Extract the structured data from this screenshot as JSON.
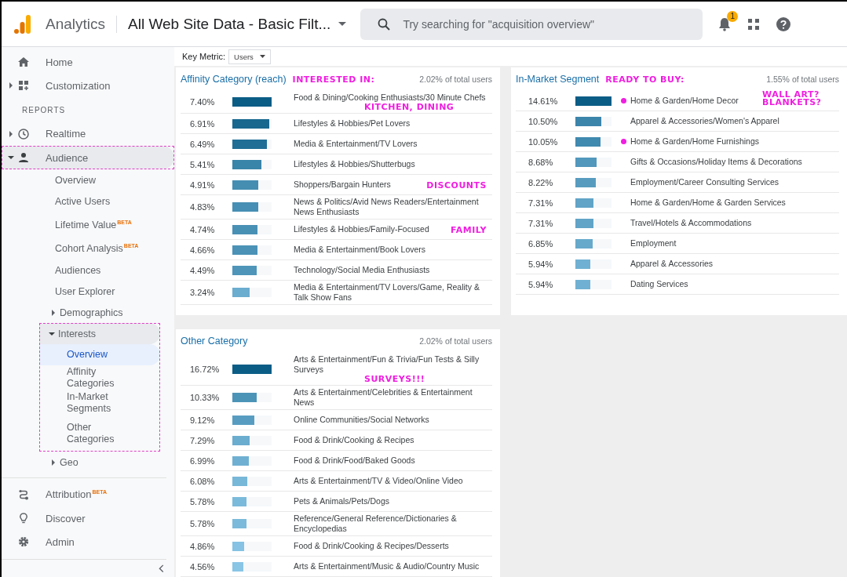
{
  "header": {
    "product": "Analytics",
    "view": "All Web Site Data - Basic Filt...",
    "search": {
      "placeholder": "Try searching for \"acquisition overview\""
    },
    "notifications": "1"
  },
  "sidebar": {
    "items": [
      {
        "label": "Home",
        "kind": "item"
      },
      {
        "label": "Customization",
        "kind": "item",
        "expanded": false
      },
      {
        "label": "REPORTS",
        "kind": "section"
      },
      {
        "label": "Realtime",
        "kind": "item",
        "expanded": false
      },
      {
        "label": "Audience",
        "kind": "item",
        "expanded": true,
        "highlighted": true,
        "children": [
          {
            "label": "Overview",
            "selected": false
          },
          {
            "label": "Active Users",
            "selected": false
          },
          {
            "label": "Lifetime Value",
            "badge": "BETA",
            "selected": false
          },
          {
            "label": "Cohort Analysis",
            "badge": "BETA",
            "selected": false
          },
          {
            "label": "Audiences",
            "selected": false
          },
          {
            "label": "User Explorer",
            "selected": false
          },
          {
            "label": "Demographics",
            "expanded": false,
            "selected": false
          },
          {
            "label": "Interests",
            "expanded": true,
            "highlighted": true,
            "selected": false,
            "children": [
              {
                "label": "Overview",
                "selected": true
              },
              {
                "label": "Affinity Categories",
                "selected": false
              },
              {
                "label": "In-Market Segments",
                "selected": false
              },
              {
                "label": "Other Categories",
                "selected": false
              }
            ]
          },
          {
            "label": "Geo",
            "expanded": false,
            "selected": false
          }
        ]
      },
      {
        "label": "Attribution",
        "kind": "item",
        "badge": "BETA"
      },
      {
        "label": "Discover",
        "kind": "item"
      },
      {
        "label": "Admin",
        "kind": "item"
      }
    ]
  },
  "key_metric": {
    "label": "Key Metric:",
    "value": "Users"
  },
  "panels": [
    {
      "title": "Affinity Category (reach)",
      "note": "INTERESTED IN:",
      "share": "2.02% of total users",
      "rows": [
        {
          "value": "7.40%",
          "level": 1.0,
          "label": "Food & Dining/Cooking Enthusiasts/30 Minute Chefs",
          "note": "KITCHEN, DINING"
        },
        {
          "value": "6.91%",
          "level": 0.93,
          "label": "Lifestyles & Hobbies/Pet Lovers"
        },
        {
          "value": "6.49%",
          "level": 0.88,
          "label": "Media & Entertainment/TV Lovers"
        },
        {
          "value": "5.41%",
          "level": 0.73,
          "label": "Lifestyles & Hobbies/Shutterbugs"
        },
        {
          "value": "4.91%",
          "level": 0.66,
          "label": "Shoppers/Bargain Hunters",
          "note": "DISCOUNTS"
        },
        {
          "value": "4.83%",
          "level": 0.65,
          "label": "News & Politics/Avid News Readers/Entertainment News Enthusiasts"
        },
        {
          "value": "4.74%",
          "level": 0.64,
          "label": "Lifestyles & Hobbies/Family-Focused",
          "note": "FAMILY"
        },
        {
          "value": "4.66%",
          "level": 0.63,
          "label": "Media & Entertainment/Book Lovers"
        },
        {
          "value": "4.49%",
          "level": 0.61,
          "label": "Technology/Social Media Enthusiasts"
        },
        {
          "value": "3.24%",
          "level": 0.44,
          "label": "Media & Entertainment/TV Lovers/Game, Reality & Talk Show Fans"
        }
      ]
    },
    {
      "title": "In-Market Segment",
      "note": "READY TO BUY:",
      "share": "1.55% of total users",
      "rows": [
        {
          "value": "14.61%",
          "level": 1.0,
          "label": "Home & Garden/Home Decor",
          "note": "WALL ART? BLANKETS?",
          "marked": true
        },
        {
          "value": "10.50%",
          "level": 0.72,
          "label": "Apparel & Accessories/Women's Apparel",
          "marked": false
        },
        {
          "value": "10.05%",
          "level": 0.69,
          "label": "Home & Garden/Home Furnishings",
          "marked": true
        },
        {
          "value": "8.68%",
          "level": 0.59,
          "label": "Gifts & Occasions/Holiday Items & Decorations",
          "marked": false
        },
        {
          "value": "8.22%",
          "level": 0.56,
          "label": "Employment/Career Consulting Services",
          "marked": false
        },
        {
          "value": "7.31%",
          "level": 0.5,
          "label": "Home & Garden/Home & Garden Services",
          "marked": false
        },
        {
          "value": "7.31%",
          "level": 0.5,
          "label": "Travel/Hotels & Accommodations",
          "marked": false
        },
        {
          "value": "6.85%",
          "level": 0.47,
          "label": "Employment",
          "marked": false
        },
        {
          "value": "5.94%",
          "level": 0.41,
          "label": "Apparel & Accessories",
          "marked": false
        },
        {
          "value": "5.94%",
          "level": 0.41,
          "label": "Dating Services",
          "marked": false
        }
      ]
    },
    {
      "title": "Other Category",
      "share": "2.02% of total users",
      "rows": [
        {
          "value": "16.72%",
          "level": 1.0,
          "label": "Arts & Entertainment/Fun & Trivia/Fun Tests & Silly Surveys",
          "note": "SURVEYS!!!"
        },
        {
          "value": "10.33%",
          "level": 0.62,
          "label": "Arts & Entertainment/Celebrities & Entertainment News"
        },
        {
          "value": "9.12%",
          "level": 0.55,
          "label": "Online Communities/Social Networks"
        },
        {
          "value": "7.29%",
          "level": 0.44,
          "label": "Food & Drink/Cooking & Recipes"
        },
        {
          "value": "6.99%",
          "level": 0.42,
          "label": "Food & Drink/Food/Baked Goods"
        },
        {
          "value": "6.08%",
          "level": 0.37,
          "label": "Arts & Entertainment/TV & Video/Online Video"
        },
        {
          "value": "5.78%",
          "level": 0.35,
          "label": "Pets & Animals/Pets/Dogs"
        },
        {
          "value": "5.78%",
          "level": 0.35,
          "label": "Reference/General Reference/Dictionaries & Encyclopedias"
        },
        {
          "value": "4.86%",
          "level": 0.29,
          "label": "Food & Drink/Cooking & Recipes/Desserts"
        },
        {
          "value": "4.56%",
          "level": 0.27,
          "label": "Arts & Entertainment/Music & Audio/Country Music"
        }
      ]
    }
  ]
}
